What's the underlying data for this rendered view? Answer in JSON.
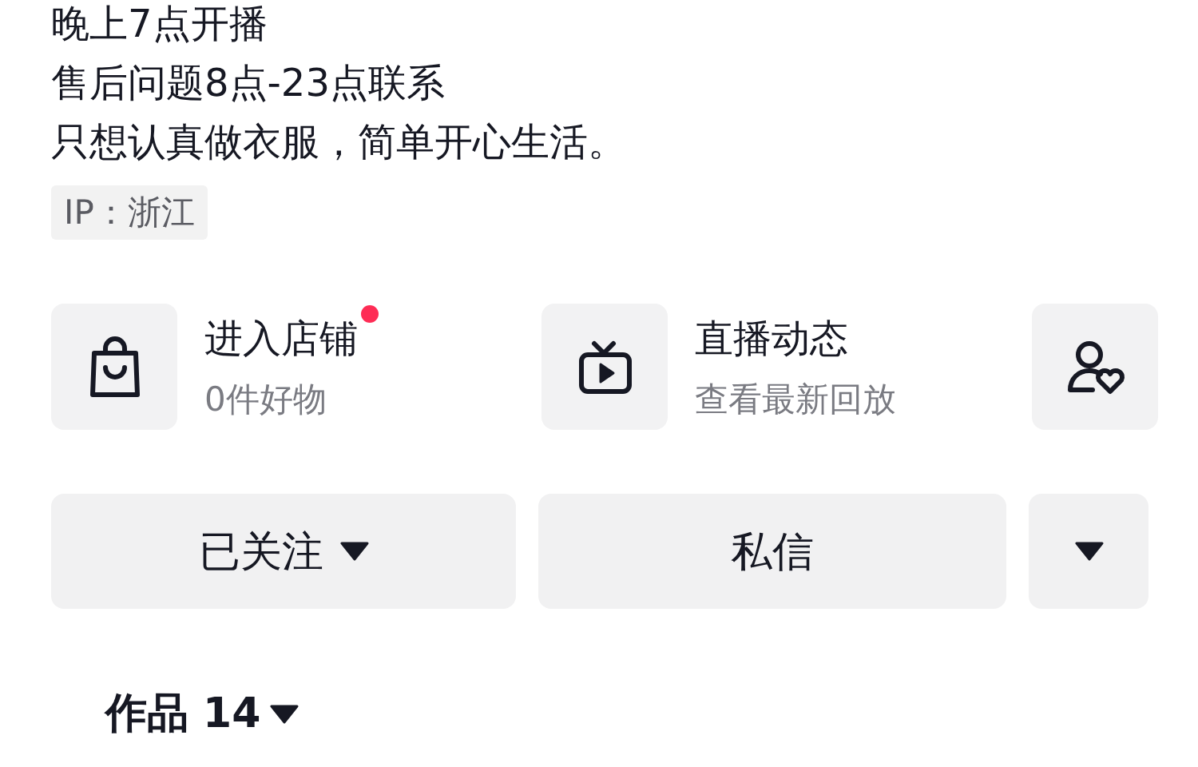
{
  "bio": [
    "晚上7点开播",
    "售后问题8点-23点联系",
    "只想认真做衣服，简单开心生活。"
  ],
  "ip_tag": "IP：浙江",
  "shortcuts": [
    {
      "kind": "shop",
      "title": "进入店铺",
      "subtitle": "0件好物",
      "badge": true
    },
    {
      "kind": "live",
      "title": "直播动态",
      "subtitle": "查看最新回放",
      "badge": false
    },
    {
      "kind": "fans",
      "badge": false
    }
  ],
  "buttons": [
    {
      "kind": "follow",
      "label": "已关注"
    },
    {
      "kind": "message",
      "label": "私信"
    },
    {
      "kind": "more"
    }
  ],
  "tab": {
    "label": "作品 14"
  }
}
